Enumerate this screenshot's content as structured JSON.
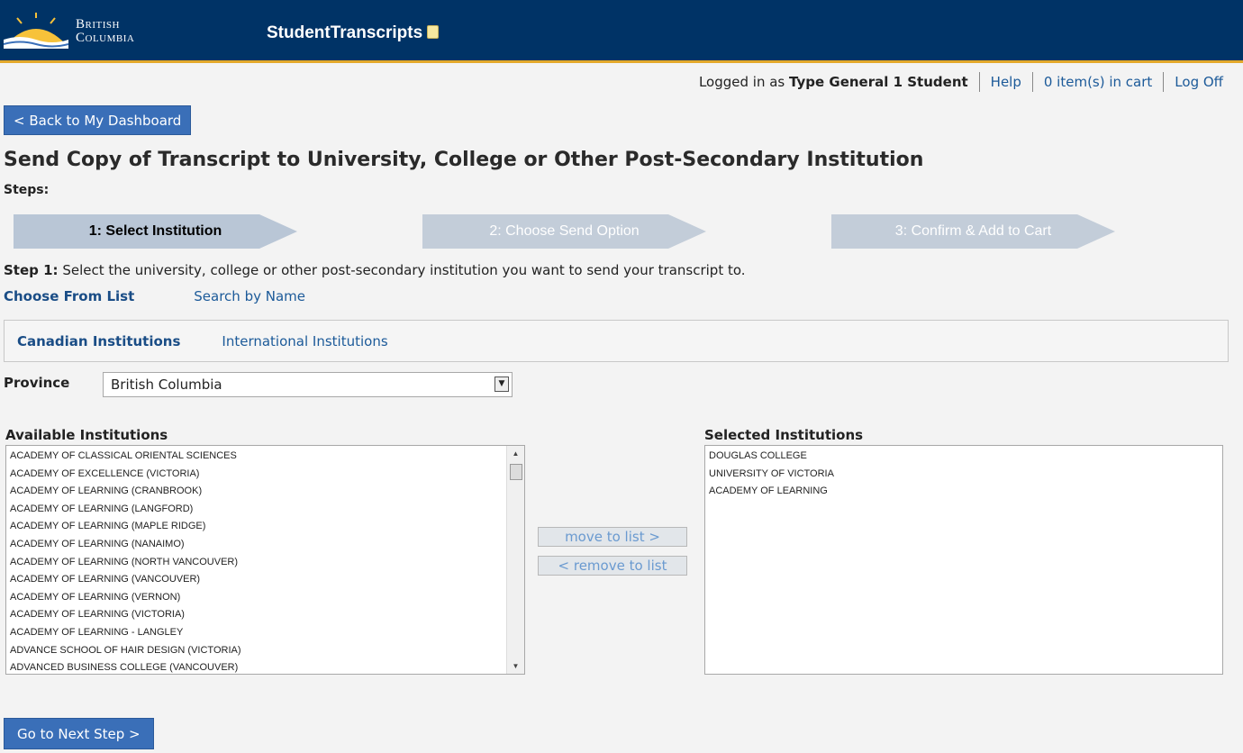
{
  "header": {
    "logo_line1": "British",
    "logo_line2": "Columbia",
    "app_title": "StudentTranscripts"
  },
  "userbar": {
    "logged_in_prefix": "Logged in as",
    "user_name": "Type General 1 Student",
    "help": "Help",
    "cart": "0 item(s) in cart",
    "logoff": "Log Off"
  },
  "back_button": "< Back to My Dashboard",
  "page_title": "Send Copy of Transcript to University, College or Other Post-Secondary Institution",
  "steps_label": "Steps:",
  "steps": [
    {
      "label": "1: Select Institution",
      "active": true
    },
    {
      "label": "2: Choose Send Option",
      "active": false
    },
    {
      "label": "3: Confirm & Add to Cart",
      "active": false
    }
  ],
  "step1": {
    "prefix": "Step 1:",
    "text": " Select the university, college or other post-secondary institution you want to send your transcript to."
  },
  "choose_tabs": [
    {
      "label": "Choose From List",
      "active": true
    },
    {
      "label": "Search by Name",
      "active": false
    }
  ],
  "institution_tabs": [
    {
      "label": "Canadian Institutions",
      "active": true
    },
    {
      "label": "International Institutions",
      "active": false
    }
  ],
  "province": {
    "label": "Province",
    "value": "British Columbia"
  },
  "available": {
    "label": "Available Institutions",
    "items": [
      "ACADEMY OF CLASSICAL ORIENTAL SCIENCES",
      "ACADEMY OF EXCELLENCE (VICTORIA)",
      "ACADEMY OF LEARNING (CRANBROOK)",
      "ACADEMY OF LEARNING (LANGFORD)",
      "ACADEMY OF LEARNING (MAPLE RIDGE)",
      "ACADEMY OF LEARNING (NANAIMO)",
      "ACADEMY OF LEARNING (NORTH VANCOUVER)",
      "ACADEMY OF LEARNING (VANCOUVER)",
      "ACADEMY OF LEARNING (VERNON)",
      "ACADEMY OF LEARNING (VICTORIA)",
      "ACADEMY OF LEARNING - LANGLEY",
      "ADVANCE SCHOOL OF HAIR DESIGN (VICTORIA)",
      "ADVANCED BUSINESS COLLEGE (VANCOUVER)"
    ]
  },
  "selected": {
    "label": "Selected Institutions",
    "items": [
      "DOUGLAS COLLEGE",
      "UNIVERSITY OF VICTORIA",
      "ACADEMY OF LEARNING"
    ]
  },
  "move_to_list": "move to list >",
  "remove_to_list": "< remove to list",
  "next_button": "Go to Next Step >",
  "colors": {
    "header_bg": "#003366",
    "accent_gold": "#e3a82b",
    "button_blue": "#3a6fb8",
    "link_blue": "#1c5a99"
  }
}
